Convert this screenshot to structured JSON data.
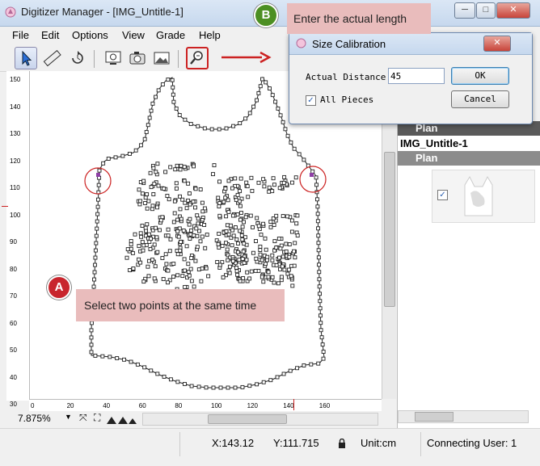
{
  "window": {
    "title": "Digitizer Manager - [IMG_Untitle-1]",
    "min": "─",
    "max": "□",
    "close": "✕"
  },
  "menu": [
    "File",
    "Edit",
    "Options",
    "View",
    "Grade",
    "Help"
  ],
  "toolbar_icons": [
    "select-arrow-icon",
    "ruler-icon",
    "rotate-icon",
    "monitor-icon",
    "camera-icon",
    "picture-icon",
    "zoom-search-icon"
  ],
  "ruler_left": [
    "150",
    "140",
    "130",
    "120",
    "110",
    "100",
    "90",
    "80",
    "70",
    "60",
    "50",
    "40",
    "30"
  ],
  "ruler_bottom": [
    "0",
    "20",
    "40",
    "60",
    "80",
    "100",
    "120",
    "140",
    "160"
  ],
  "zoom": {
    "value": "7.875%",
    "arrow": "▼"
  },
  "status": {
    "x": "X:143.12",
    "y": "Y:111.715",
    "unit": "Unit:cm",
    "user": "Connecting User: 1"
  },
  "panel": {
    "plan1": "Plan",
    "piece_name": "IMG_Untitle-1",
    "plan2": "Plan"
  },
  "dialog": {
    "title": "Size Calibration",
    "distance_label": "Actual Distance:",
    "distance_value": "45",
    "ok": "OK",
    "cancel": "Cancel",
    "all_pieces": "All Pieces",
    "all_pieces_checked": true
  },
  "annotations": {
    "a_badge": "A",
    "a_text": "Select two points at the same time",
    "b_badge": "B",
    "b_text": "Enter the actual length",
    "arrow": "→"
  },
  "colors": {
    "badge_red": "#c8252d",
    "badge_green": "#4c8f22",
    "callout": "#e9bcbc",
    "accent_red": "#cc2222",
    "marker_purple": "#8e3fa5"
  }
}
